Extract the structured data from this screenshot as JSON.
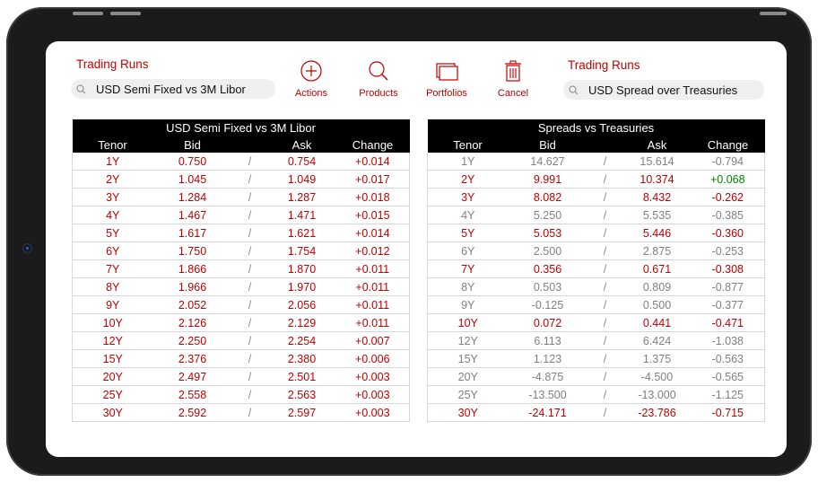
{
  "colors": {
    "accent": "#c00000",
    "muted": "#808080",
    "positive": "#008000"
  },
  "left_panel": {
    "label": "Trading Runs",
    "search_value": "USD Semi Fixed vs 3M Libor"
  },
  "right_panel": {
    "label": "Trading Runs",
    "search_value": "USD Spread over Treasuries"
  },
  "toolbar": {
    "actions": {
      "label": "Actions",
      "icon": "plus-circle-icon"
    },
    "products": {
      "label": "Products",
      "icon": "magnifier-icon"
    },
    "portfolios": {
      "label": "Portfolios",
      "icon": "windows-icon"
    },
    "cancel": {
      "label": "Cancel",
      "icon": "trash-icon"
    }
  },
  "left_table": {
    "title": "USD Semi Fixed vs 3M Libor",
    "headers": {
      "tenor": "Tenor",
      "bid": "Bid",
      "ask": "Ask",
      "change": "Change"
    },
    "rows": [
      {
        "tenor": "1Y",
        "bid": "0.750",
        "ask": "0.754",
        "change": "+0.014",
        "style": "red"
      },
      {
        "tenor": "2Y",
        "bid": "1.045",
        "ask": "1.049",
        "change": "+0.017",
        "style": "red"
      },
      {
        "tenor": "3Y",
        "bid": "1.284",
        "ask": "1.287",
        "change": "+0.018",
        "style": "red"
      },
      {
        "tenor": "4Y",
        "bid": "1.467",
        "ask": "1.471",
        "change": "+0.015",
        "style": "red"
      },
      {
        "tenor": "5Y",
        "bid": "1.617",
        "ask": "1.621",
        "change": "+0.014",
        "style": "red"
      },
      {
        "tenor": "6Y",
        "bid": "1.750",
        "ask": "1.754",
        "change": "+0.012",
        "style": "red"
      },
      {
        "tenor": "7Y",
        "bid": "1.866",
        "ask": "1.870",
        "change": "+0.011",
        "style": "red"
      },
      {
        "tenor": "8Y",
        "bid": "1.966",
        "ask": "1.970",
        "change": "+0.011",
        "style": "red"
      },
      {
        "tenor": "9Y",
        "bid": "2.052",
        "ask": "2.056",
        "change": "+0.011",
        "style": "red"
      },
      {
        "tenor": "10Y",
        "bid": "2.126",
        "ask": "2.129",
        "change": "+0.011",
        "style": "red"
      },
      {
        "tenor": "12Y",
        "bid": "2.250",
        "ask": "2.254",
        "change": "+0.007",
        "style": "red"
      },
      {
        "tenor": "15Y",
        "bid": "2.376",
        "ask": "2.380",
        "change": "+0.006",
        "style": "red"
      },
      {
        "tenor": "20Y",
        "bid": "2.497",
        "ask": "2.501",
        "change": "+0.003",
        "style": "red"
      },
      {
        "tenor": "25Y",
        "bid": "2.558",
        "ask": "2.563",
        "change": "+0.003",
        "style": "red"
      },
      {
        "tenor": "30Y",
        "bid": "2.592",
        "ask": "2.597",
        "change": "+0.003",
        "style": "red"
      }
    ]
  },
  "right_table": {
    "title": "Spreads vs Treasuries",
    "headers": {
      "tenor": "Tenor",
      "bid": "Bid",
      "ask": "Ask",
      "change": "Change"
    },
    "rows": [
      {
        "tenor": "1Y",
        "bid": "14.627",
        "ask": "15.614",
        "change": "-0.794",
        "style": "grey"
      },
      {
        "tenor": "2Y",
        "bid": "9.991",
        "ask": "10.374",
        "change": "+0.068",
        "style": "red",
        "change_style": "green"
      },
      {
        "tenor": "3Y",
        "bid": "8.082",
        "ask": "8.432",
        "change": "-0.262",
        "style": "red"
      },
      {
        "tenor": "4Y",
        "bid": "5.250",
        "ask": "5.535",
        "change": "-0.385",
        "style": "grey"
      },
      {
        "tenor": "5Y",
        "bid": "5.053",
        "ask": "5.446",
        "change": "-0.360",
        "style": "red"
      },
      {
        "tenor": "6Y",
        "bid": "2.500",
        "ask": "2.875",
        "change": "-0.253",
        "style": "grey"
      },
      {
        "tenor": "7Y",
        "bid": "0.356",
        "ask": "0.671",
        "change": "-0.308",
        "style": "red"
      },
      {
        "tenor": "8Y",
        "bid": "0.503",
        "ask": "0.809",
        "change": "-0.877",
        "style": "grey"
      },
      {
        "tenor": "9Y",
        "bid": "-0.125",
        "ask": "0.500",
        "change": "-0.377",
        "style": "grey"
      },
      {
        "tenor": "10Y",
        "bid": "0.072",
        "ask": "0.441",
        "change": "-0.471",
        "style": "red"
      },
      {
        "tenor": "12Y",
        "bid": "6.113",
        "ask": "6.424",
        "change": "-1.038",
        "style": "grey"
      },
      {
        "tenor": "15Y",
        "bid": "1.123",
        "ask": "1.375",
        "change": "-0.563",
        "style": "grey"
      },
      {
        "tenor": "20Y",
        "bid": "-4.875",
        "ask": "-4.500",
        "change": "-0.565",
        "style": "grey"
      },
      {
        "tenor": "25Y",
        "bid": "-13.500",
        "ask": "-13.000",
        "change": "-1.125",
        "style": "grey"
      },
      {
        "tenor": "30Y",
        "bid": "-24.171",
        "ask": "-23.786",
        "change": "-0.715",
        "style": "red"
      }
    ]
  },
  "separator": "/"
}
